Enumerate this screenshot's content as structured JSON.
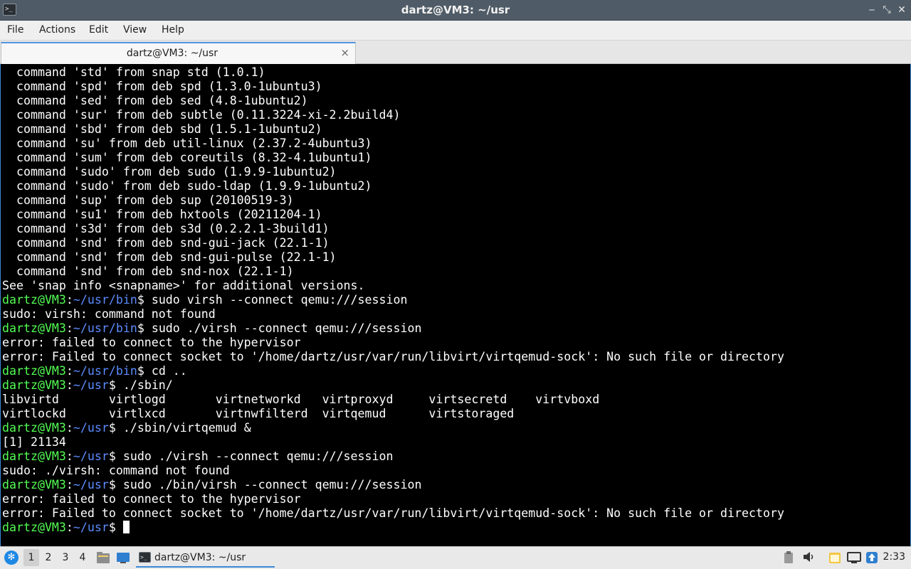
{
  "window": {
    "title": "dartz@VM3: ~/usr",
    "minimize_glyph": "‒",
    "maximize_glyph": "⤡",
    "close_glyph": "✕"
  },
  "menu": [
    "File",
    "Actions",
    "Edit",
    "View",
    "Help"
  ],
  "tabs": [
    {
      "label": "dartz@VM3: ~/usr",
      "close_glyph": "×"
    }
  ],
  "terminal": {
    "lines": [
      {
        "text": "  command 'std' from snap std (1.0.1)"
      },
      {
        "text": "  command 'spd' from deb spd (1.3.0-1ubuntu3)"
      },
      {
        "text": "  command 'sed' from deb sed (4.8-1ubuntu2)"
      },
      {
        "text": "  command 'sur' from deb subtle (0.11.3224-xi-2.2build4)"
      },
      {
        "text": "  command 'sbd' from deb sbd (1.5.1-1ubuntu2)"
      },
      {
        "text": "  command 'su' from deb util-linux (2.37.2-4ubuntu3)"
      },
      {
        "text": "  command 'sum' from deb coreutils (8.32-4.1ubuntu1)"
      },
      {
        "text": "  command 'sudo' from deb sudo (1.9.9-1ubuntu2)"
      },
      {
        "text": "  command 'sudo' from deb sudo-ldap (1.9.9-1ubuntu2)"
      },
      {
        "text": "  command 'sup' from deb sup (20100519-3)"
      },
      {
        "text": "  command 'su1' from deb hxtools (20211204-1)"
      },
      {
        "text": "  command 's3d' from deb s3d (0.2.2.1-3build1)"
      },
      {
        "text": "  command 'snd' from deb snd-gui-jack (22.1-1)"
      },
      {
        "text": "  command 'snd' from deb snd-gui-pulse (22.1-1)"
      },
      {
        "text": "  command 'snd' from deb snd-nox (22.1-1)"
      },
      {
        "text": "See 'snap info <snapname>' for additional versions."
      },
      {
        "user": "dartz@VM3",
        "sep": ":",
        "path": "~/usr/bin",
        "cmd": "$ sudo virsh --connect qemu:///session"
      },
      {
        "text": "sudo: virsh: command not found"
      },
      {
        "user": "dartz@VM3",
        "sep": ":",
        "path": "~/usr/bin",
        "cmd": "$ sudo ./virsh --connect qemu:///session"
      },
      {
        "text": "error: failed to connect to the hypervisor"
      },
      {
        "text": "error: Failed to connect socket to '/home/dartz/usr/var/run/libvirt/virtqemud-sock': No such file or directory"
      },
      {
        "user": "dartz@VM3",
        "sep": ":",
        "path": "~/usr/bin",
        "cmd": "$ cd .."
      },
      {
        "user": "dartz@VM3",
        "sep": ":",
        "path": "~/usr",
        "cmd": "$ ./sbin/"
      },
      {
        "text": "libvirtd       virtlogd       virtnetworkd   virtproxyd     virtsecretd    virtvboxd"
      },
      {
        "text": "virtlockd      virtlxcd       virtnwfilterd  virtqemud      virtstoraged"
      },
      {
        "user": "dartz@VM3",
        "sep": ":",
        "path": "~/usr",
        "cmd": "$ ./sbin/virtqemud &"
      },
      {
        "text": "[1] 21134"
      },
      {
        "user": "dartz@VM3",
        "sep": ":",
        "path": "~/usr",
        "cmd": "$ sudo ./virsh --connect qemu:///session"
      },
      {
        "text": "sudo: ./virsh: command not found"
      },
      {
        "user": "dartz@VM3",
        "sep": ":",
        "path": "~/usr",
        "cmd": "$ sudo ./bin/virsh --connect qemu:///session"
      },
      {
        "text": "error: failed to connect to the hypervisor"
      },
      {
        "text": "error: Failed to connect socket to '/home/dartz/usr/var/run/libvirt/virtqemud-sock': No such file or directory"
      },
      {
        "user": "dartz@VM3",
        "sep": ":",
        "path": "~/usr",
        "cmd": "$ ",
        "cursor": true
      }
    ]
  },
  "taskbar": {
    "workspaces": [
      "1",
      "2",
      "3",
      "4"
    ],
    "active_workspace": "1",
    "task_label": "dartz@VM3: ~/usr",
    "clock": "2:33"
  },
  "colors": {
    "prompt_user": "#54ff54",
    "prompt_path": "#5c8cff",
    "accent": "#3b8ad8"
  }
}
